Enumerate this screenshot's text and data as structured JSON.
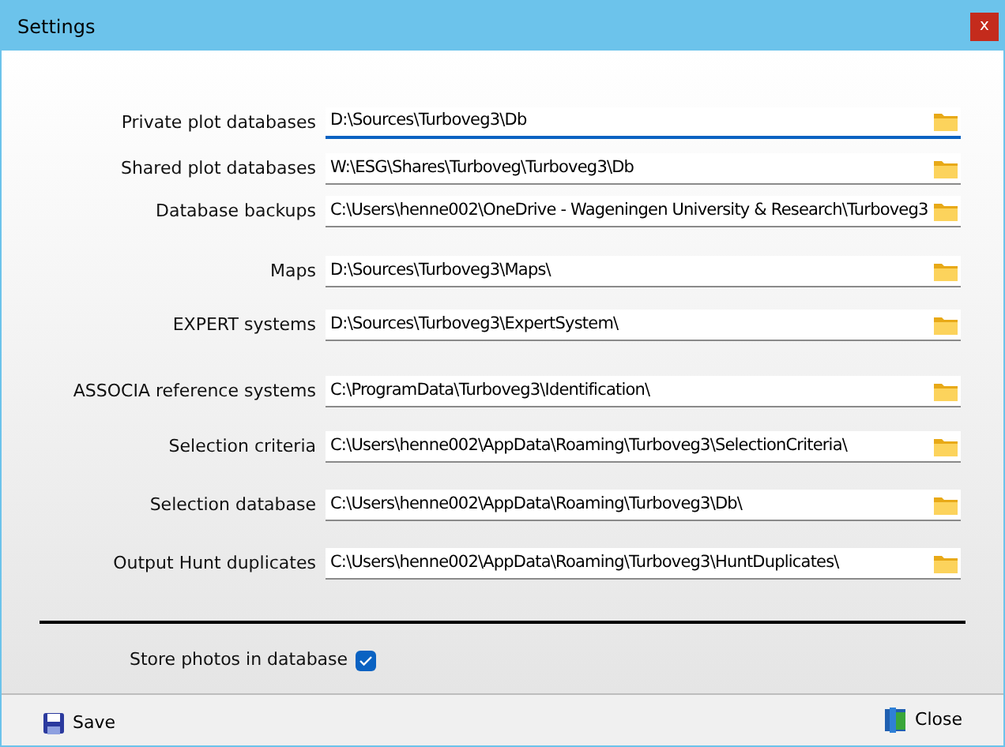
{
  "window": {
    "title": "Settings",
    "close": "x"
  },
  "paths": [
    {
      "label": "Private plot databases",
      "value": "D:\\Sources\\Turboveg3\\Db",
      "focused": true
    },
    {
      "label": "Shared plot databases",
      "value": "W:\\ESG\\Shares\\Turboveg\\Turboveg3\\Db",
      "focused": false
    },
    {
      "label": "Database backups",
      "value": "C:\\Users\\henne002\\OneDrive - Wageningen University & Research\\Turboveg3",
      "focused": false
    },
    {
      "label": "Maps",
      "value": "D:\\Sources\\Turboveg3\\Maps\\",
      "focused": false
    },
    {
      "label": "EXPERT systems",
      "value": "D:\\Sources\\Turboveg3\\ExpertSystem\\",
      "focused": false
    },
    {
      "label": "ASSOCIA reference systems",
      "value": "C:\\ProgramData\\Turboveg3\\Identification\\",
      "focused": false
    },
    {
      "label": "Selection criteria",
      "value": "C:\\Users\\henne002\\AppData\\Roaming\\Turboveg3\\SelectionCriteria\\",
      "focused": false
    },
    {
      "label": "Selection database",
      "value": "C:\\Users\\henne002\\AppData\\Roaming\\Turboveg3\\Db\\",
      "focused": false
    },
    {
      "label": "Output Hunt duplicates",
      "value": "C:\\Users\\henne002\\AppData\\Roaming\\Turboveg3\\HuntDuplicates\\",
      "focused": false
    }
  ],
  "store_photos": {
    "label": "Store photos in database",
    "checked": true
  },
  "footer": {
    "save": "Save",
    "close": "Close"
  }
}
